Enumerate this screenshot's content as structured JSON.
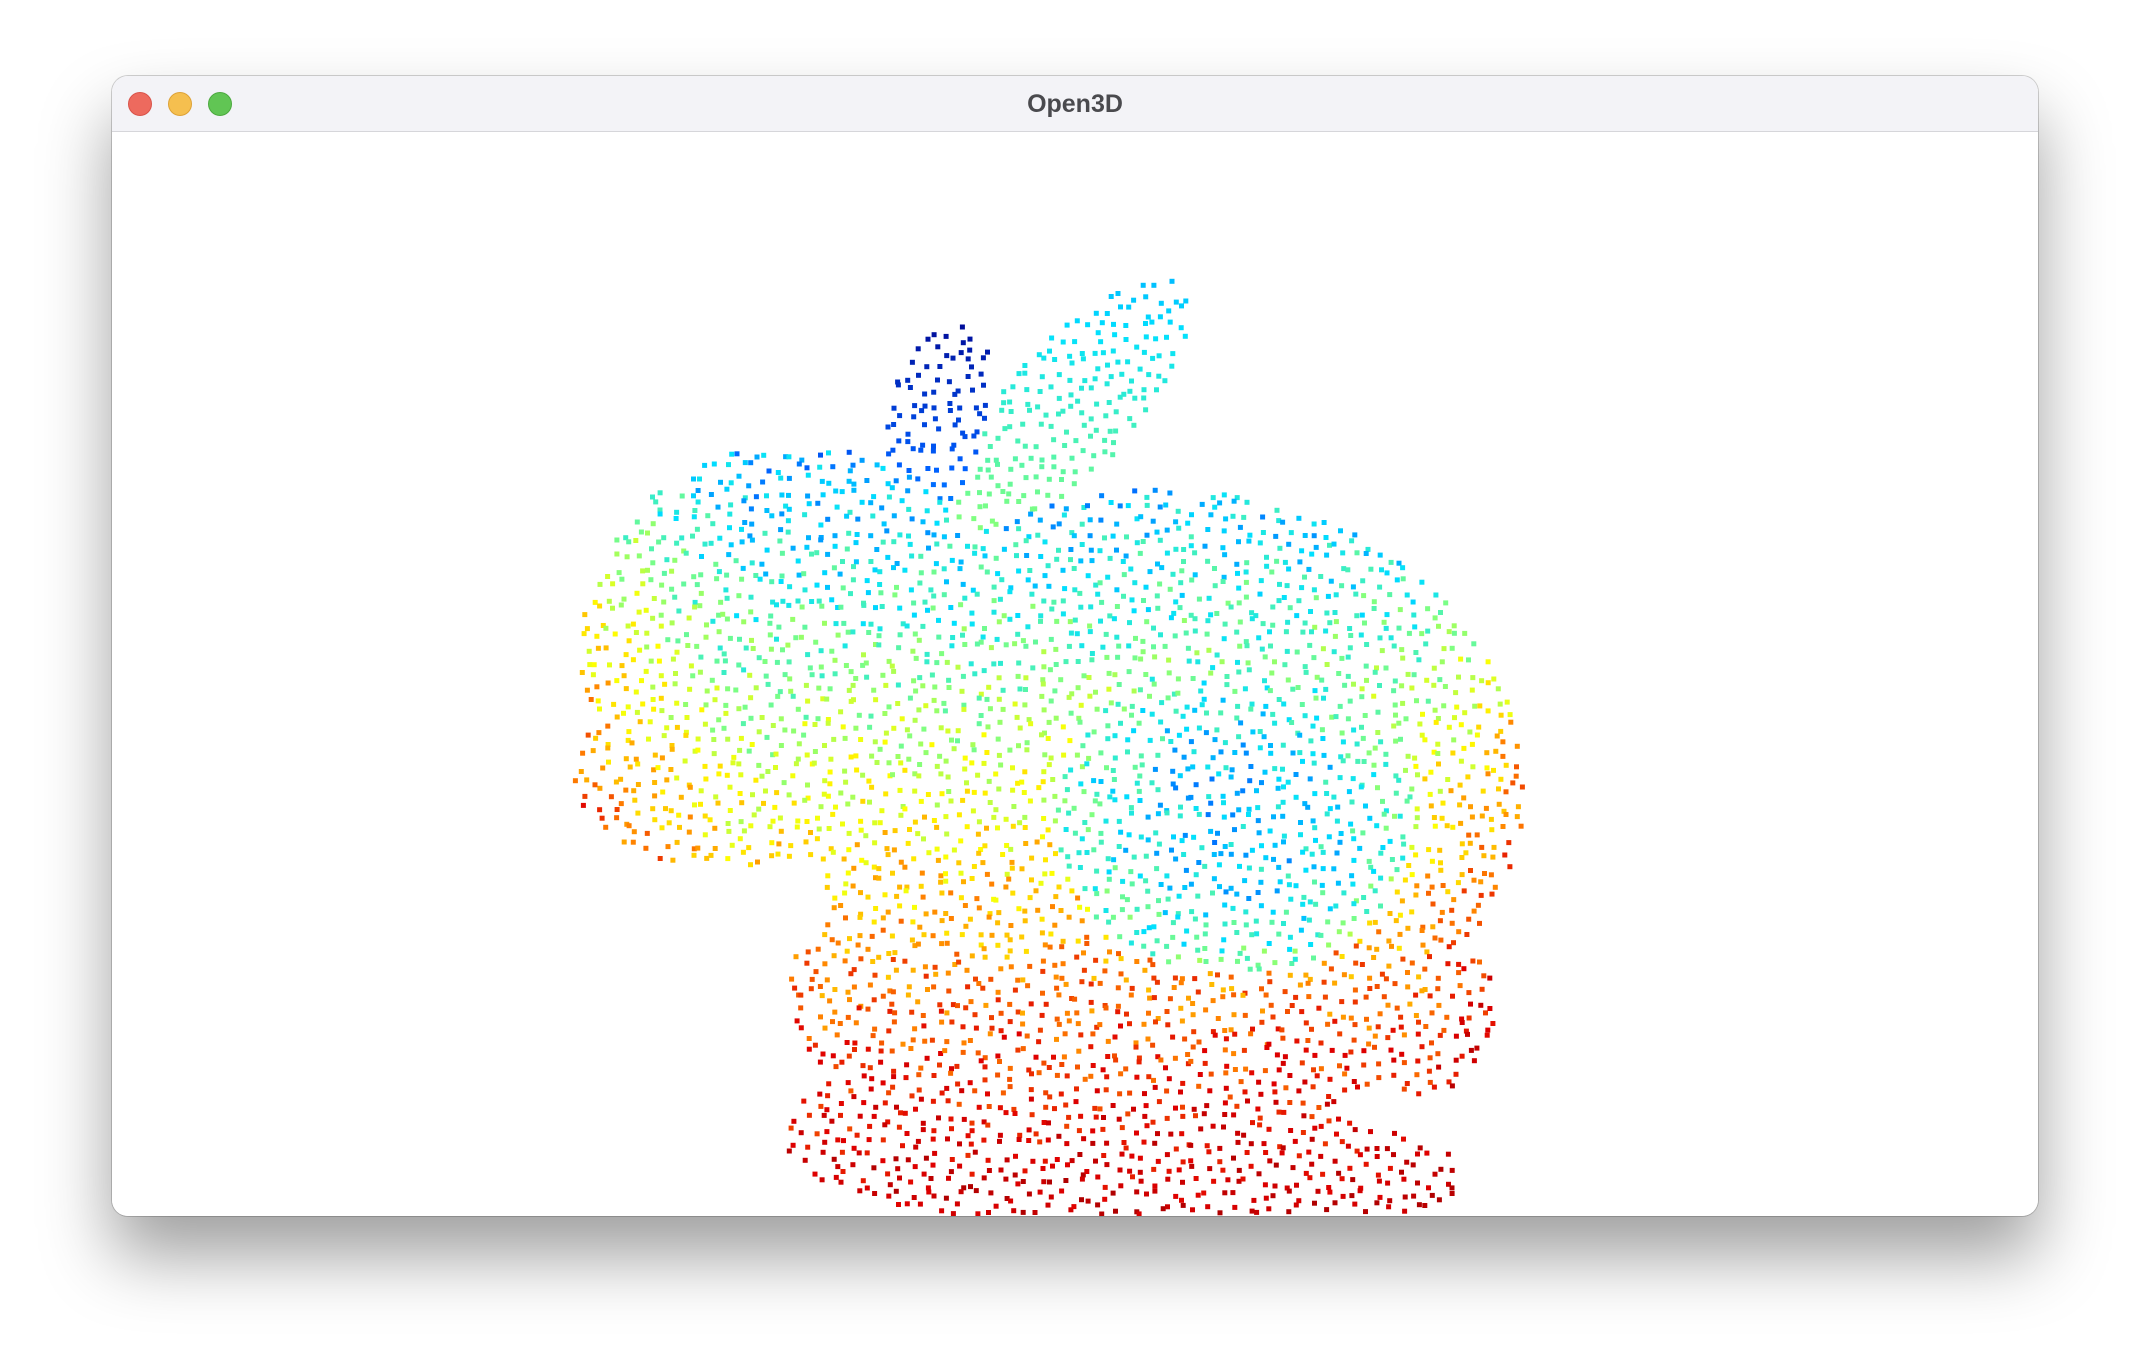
{
  "window": {
    "title": "Open3D",
    "controls": {
      "close": "close-button",
      "minimize": "minimize-button",
      "maximize": "maximize-button"
    },
    "control_colors": {
      "close": "#ed6a5e",
      "minimize": "#f5bf4f",
      "maximize": "#61c554"
    }
  },
  "viewport": {
    "background": "#ffffff",
    "content": "point-cloud",
    "colormap": "jet",
    "colormap_stops": [
      "#00008b",
      "#0060ff",
      "#00e0ff",
      "#80ff80",
      "#ffff00",
      "#ff8000",
      "#e00000",
      "#b00000"
    ]
  }
}
